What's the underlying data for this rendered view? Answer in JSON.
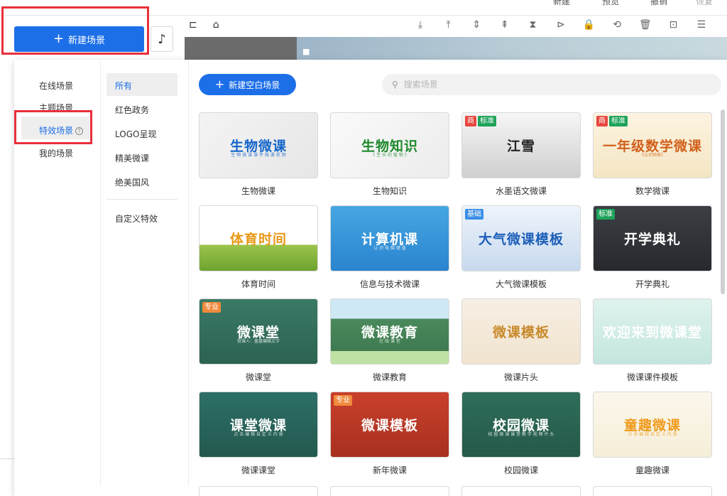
{
  "top_bar": {
    "labels": [
      "新建",
      "预览",
      "撤销",
      "恢复"
    ]
  },
  "new_scene_button": {
    "label": "新建场景",
    "plus": "+"
  },
  "music_icon": "♪",
  "toolbar": {
    "left_icons": [
      "ruler-icon",
      "home-icon"
    ],
    "left_glyphs": [
      "⊏",
      "⌂"
    ],
    "right_icons": [
      "align-bottom-icon",
      "align-top-icon",
      "align-middle-icon",
      "distribute-icon",
      "flip-horizontal-icon",
      "flip-vertical-icon",
      "lock-icon",
      "link-icon",
      "delete-icon",
      "screenshot-icon",
      "more-icon"
    ],
    "right_glyphs": [
      "⤓",
      "⤒",
      "⇕",
      "⇞",
      "⧗",
      "⊳",
      "🔒",
      "⟲",
      "🗑",
      "⊡",
      "☰"
    ]
  },
  "categories": [
    {
      "label": "在线场景",
      "active": false
    },
    {
      "label": "主题场景",
      "active": false
    },
    {
      "label": "特效场景",
      "active": true
    },
    {
      "label": "我的场景",
      "active": false
    }
  ],
  "help_glyph": "?",
  "subcategories": [
    {
      "label": "所有",
      "active": true
    },
    {
      "label": "红色政务",
      "active": false
    },
    {
      "label": "LOGO呈现",
      "active": false
    },
    {
      "label": "精美微课",
      "active": false
    },
    {
      "label": "绝美国风",
      "active": false
    },
    {
      "label": "自定义特效",
      "active": false
    }
  ],
  "blank_scene_button": {
    "label": "新建空白场景",
    "plus": "+"
  },
  "search": {
    "placeholder": "搜索场景",
    "value": ""
  },
  "templates": [
    {
      "name": "生物微课",
      "title": "生物微课",
      "subtitle": "生 物 微 课 课 件 微 课 视 频",
      "badges": [],
      "bg": "linear-gradient(135deg,#f4f4f4,#e6e6e6)",
      "color": "#1566c9"
    },
    {
      "name": "生物知识",
      "title": "生物知识",
      "subtitle": "《 生 长 的 植 物 》",
      "badges": [],
      "bg": "linear-gradient(135deg,#fafafa,#ececec)",
      "color": "#1f8a2c"
    },
    {
      "name": "水墨语文微课",
      "title": "江雪",
      "subtitle": "",
      "badges": [
        {
          "text": "商",
          "color": "#e8473f"
        },
        {
          "text": "标准",
          "color": "#1ea35a"
        }
      ],
      "bg": "linear-gradient(180deg,#f6f6f6,#cfcfcf)",
      "color": "#222"
    },
    {
      "name": "数学微课",
      "title": "一年级数学微课",
      "subtitle": "《认识钟表》",
      "badges": [
        {
          "text": "商",
          "color": "#e8473f"
        },
        {
          "text": "标准",
          "color": "#1ea35a"
        }
      ],
      "bg": "linear-gradient(180deg,#fdf3e1,#f4e6c4)",
      "color": "#d1601b"
    },
    {
      "name": "体育时间",
      "title": "体育时间",
      "subtitle": "",
      "badges": [],
      "bg": "linear-gradient(180deg,#ffffff 0,#ffffff 60%,#9bc44b 60%,#6ea32f 100%)",
      "color": "#e89816"
    },
    {
      "name": "信息与技术微课",
      "title": "计算机课",
      "subtitle": "认 识 电 脑 键 盘",
      "badges": [],
      "bg": "linear-gradient(180deg,#46a6e2,#2a84cf)",
      "color": "#ffffff"
    },
    {
      "name": "大气微课模板",
      "title": "大气微课模板",
      "subtitle": "",
      "badges": [
        {
          "text": "基础",
          "color": "#3a8ee6"
        }
      ],
      "bg": "linear-gradient(180deg,#eef4fb,#c7d9ee)",
      "color": "#1d5fb8"
    },
    {
      "name": "开学典礼",
      "title": "开学典礼",
      "subtitle": "",
      "badges": [
        {
          "text": "标准",
          "color": "#1ea35a"
        }
      ],
      "bg": "linear-gradient(180deg,#3b3f44,#262a2e)",
      "color": "#ffffff"
    },
    {
      "name": "微课堂",
      "title": "微课堂",
      "subtitle": "授课人：盘盘编辑文字",
      "badges": [
        {
          "text": "专业",
          "color": "#f08a3c"
        }
      ],
      "bg": "linear-gradient(180deg,#3a7a66,#2c6252)",
      "color": "#ffffff"
    },
    {
      "name": "微课教育",
      "title": "微课教育",
      "subtitle": "在 线 课 堂",
      "badges": [],
      "bg": "linear-gradient(180deg,#cfe8f6 0,#cfe8f6 30%,#4a8a5c 30%,#3f7a50 80%,#bfe2a4 80%)",
      "color": "#ffffff"
    },
    {
      "name": "微课片头",
      "title": "微课模板",
      "subtitle": "",
      "badges": [],
      "bg": "linear-gradient(180deg,#f7efe4,#f1e3cf)",
      "color": "#c8892a"
    },
    {
      "name": "微课课件模板",
      "title": "欢迎来到微课堂",
      "subtitle": "",
      "badges": [],
      "bg": "linear-gradient(180deg,#dff2ee,#c4e6df)",
      "color": "#ffffff"
    },
    {
      "name": "微课课堂",
      "title": "课堂微课",
      "subtitle": "点 击 编 辑 自 定 义 内 容",
      "badges": [],
      "bg": "linear-gradient(180deg,#2d6f66,#23594f)",
      "color": "#ffffff"
    },
    {
      "name": "新年微课",
      "title": "微课模板",
      "subtitle": "",
      "badges": [
        {
          "text": "专业",
          "color": "#f08a3c"
        }
      ],
      "bg": "linear-gradient(180deg,#c9402c,#a8301f)",
      "color": "#ffffff"
    },
    {
      "name": "校园微课",
      "title": "校园微课",
      "subtitle": "校 园 微 课 课 堂 教 学 视 频 片 头",
      "badges": [],
      "bg": "linear-gradient(180deg,#2f6d5a,#25594a)",
      "color": "#ffffff"
    },
    {
      "name": "童趣微课",
      "title": "童趣微课",
      "subtitle": "点 击 编 辑 自 定 义 内 容",
      "badges": [],
      "bg": "linear-gradient(180deg,#fbf7ec,#f5eed8)",
      "color": "#f09a1c"
    }
  ],
  "colors": {
    "accent": "#1d6fe8",
    "highlight_border": "#e8303a"
  }
}
